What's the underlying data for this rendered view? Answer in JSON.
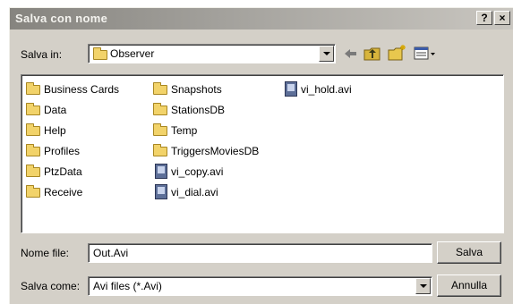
{
  "window": {
    "title": "Salva con nome",
    "help_label": "?",
    "close_label": "×"
  },
  "save_in": {
    "label": "Salva in:",
    "value": "Observer"
  },
  "toolbar": {
    "icons": [
      "back-arrow-icon",
      "up-folder-icon",
      "new-folder-icon",
      "view-menu-icon"
    ]
  },
  "files": {
    "column1": [
      "Business Cards",
      "Data",
      "Help",
      "Profiles",
      "PtzData",
      "Receive"
    ],
    "column2": [
      {
        "name": "Snapshots",
        "type": "folder"
      },
      {
        "name": "StationsDB",
        "type": "folder"
      },
      {
        "name": "Temp",
        "type": "folder"
      },
      {
        "name": "TriggersMoviesDB",
        "type": "folder"
      },
      {
        "name": "vi_copy.avi",
        "type": "avi"
      },
      {
        "name": "vi_dial.avi",
        "type": "avi"
      }
    ],
    "column3": [
      {
        "name": "vi_hold.avi",
        "type": "avi"
      }
    ]
  },
  "filename": {
    "label": "Nome file:",
    "value": "Out.Avi"
  },
  "filetype": {
    "label": "Salva come:",
    "value": "Avi files (*.Avi)"
  },
  "buttons": {
    "save": "Salva",
    "cancel": "Annulla"
  },
  "colors": {
    "dialog_bg": "#d4d0c8",
    "title_bar": "#8e8c87",
    "folder": "#f2d36a"
  }
}
